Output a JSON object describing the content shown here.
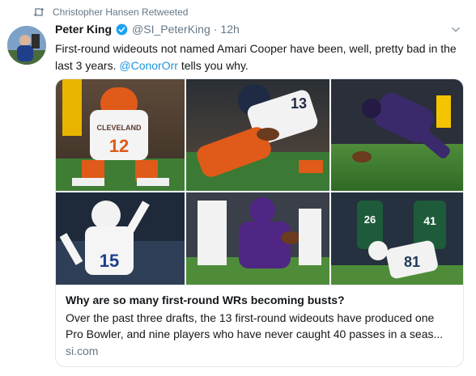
{
  "retweet": {
    "icon": "retweet-icon",
    "label": "Christopher Hansen Retweeted"
  },
  "author": {
    "name": "Peter King",
    "handle": "@SI_PeterKing",
    "separator": "·",
    "time": "12h",
    "verified_icon": "verified-badge-icon",
    "avatar_icon": "avatar"
  },
  "tweet": {
    "text_before": "First-round wideouts not named Amari Cooper have been, well, pretty bad in the last 3 years. ",
    "mention": "@ConorOrr",
    "text_after": " tells you why."
  },
  "card": {
    "title": "Why are so many first-round WRs becoming busts?",
    "description_line1": "Over the past three drafts, the 13 first-round wideouts have produced one",
    "description_line2": "Pro Bowler, and nine players who have never caught 40 passes in a seas...",
    "domain": "si.com",
    "photos": [
      {
        "jersey": "12",
        "team": "CLEVELAND"
      },
      {
        "jersey": "13"
      },
      {
        "jersey": ""
      },
      {
        "jersey": "15"
      },
      {
        "jersey": ""
      },
      {
        "jersey": "26"
      },
      {
        "jersey": "41"
      },
      {
        "jersey": "81"
      }
    ]
  },
  "colors": {
    "accent": "#1b95e0",
    "muted": "#657786",
    "text": "#14171a",
    "border": "#e1e8ed"
  }
}
